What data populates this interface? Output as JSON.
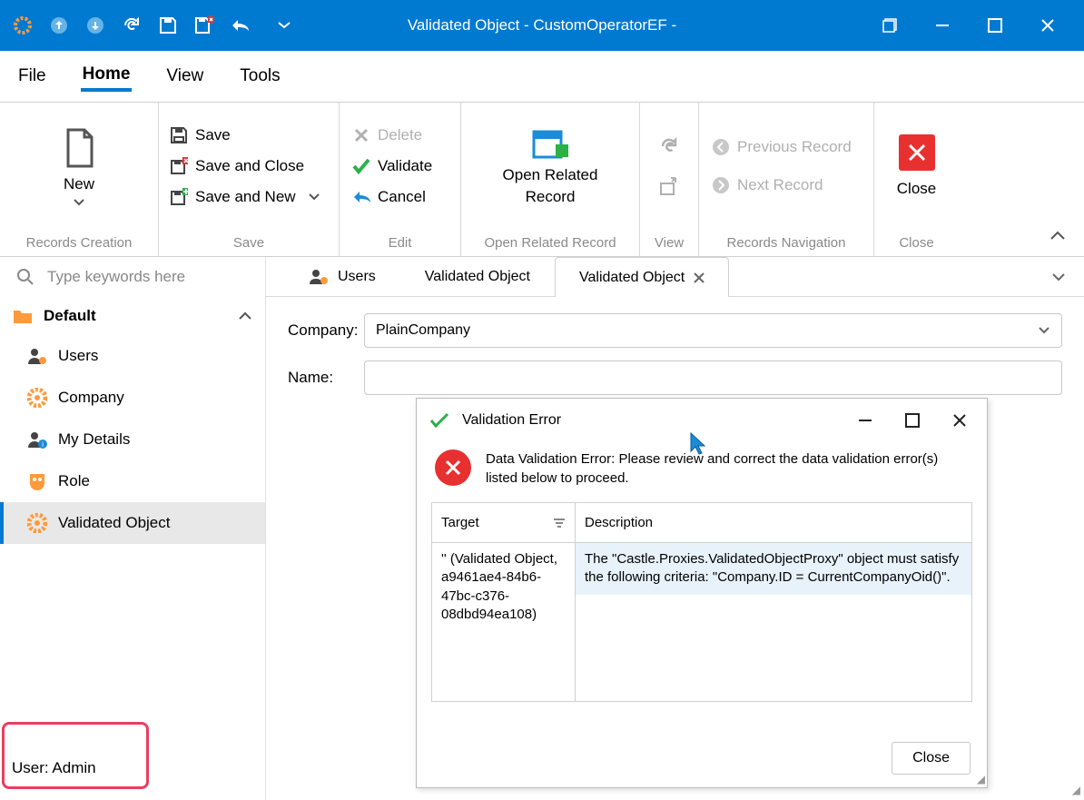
{
  "titlebar": {
    "title": "Validated Object - CustomOperatorEF -"
  },
  "menu": {
    "file": "File",
    "home": "Home",
    "view": "View",
    "tools": "Tools"
  },
  "ribbon": {
    "new": "New",
    "groups": {
      "records_creation": "Records Creation",
      "save": "Save",
      "edit": "Edit",
      "open_related": "Open Related Record",
      "view": "View",
      "nav": "Records Navigation",
      "close": "Close"
    },
    "save": "Save",
    "save_close": "Save and Close",
    "save_new": "Save and New",
    "delete": "Delete",
    "validate": "Validate",
    "cancel": "Cancel",
    "open_related": "Open Related Record",
    "open_related_line1": "Open Related",
    "open_related_line2": "Record",
    "prev": "Previous Record",
    "next": "Next Record",
    "close": "Close"
  },
  "search": {
    "placeholder": "Type keywords here"
  },
  "nav": {
    "header": "Default",
    "items": [
      "Users",
      "Company",
      "My Details",
      "Role",
      "Validated Object"
    ]
  },
  "statusbar": {
    "text": "User: Admin"
  },
  "tabs": {
    "t0": "Users",
    "t1": "Validated Object",
    "t2": "Validated Object"
  },
  "form": {
    "company_label": "Company:",
    "company_value": "PlainCompany",
    "name_label": "Name:",
    "name_value": ""
  },
  "dialog": {
    "title": "Validation Error",
    "message": "Data Validation Error: Please review and correct the data validation error(s) listed below to proceed.",
    "col_target": "Target",
    "col_desc": "Description",
    "row_target": "'' (Validated Object, a9461ae4-84b6-47bc-c376-08dbd94ea108)",
    "row_desc": "The \"Castle.Proxies.ValidatedObjectProxy\" object must satisfy the following criteria: \"Company.ID = CurrentCompanyOid()\".",
    "close": "Close"
  }
}
